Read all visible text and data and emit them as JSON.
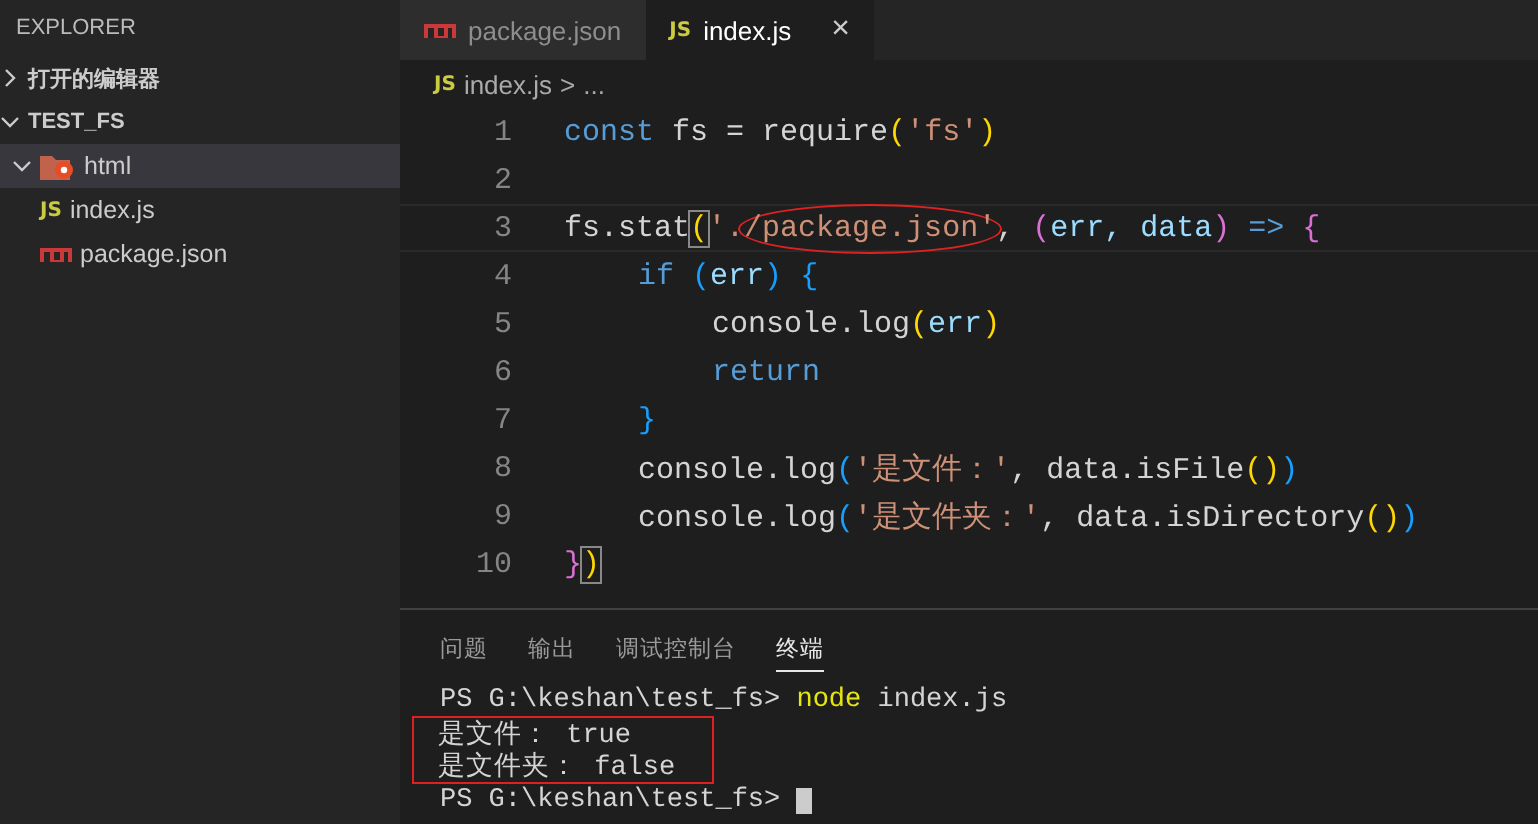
{
  "sidebar": {
    "title": "EXPLORER",
    "sections": [
      {
        "label": "打开的编辑器",
        "expanded": false
      },
      {
        "label": "TEST_FS",
        "expanded": true
      }
    ],
    "tree": [
      {
        "label": "html",
        "kind": "folder",
        "expanded": true,
        "selected": true,
        "children": [
          {
            "label": "index.js",
            "kind": "js",
            "icon_text": "JS",
            "selected": false
          },
          {
            "label": "package.json",
            "kind": "npm",
            "selected": false
          }
        ]
      }
    ]
  },
  "tabs": [
    {
      "label": "package.json",
      "kind": "npm",
      "selected": false
    },
    {
      "label": "index.js",
      "kind": "js",
      "icon_text": "JS",
      "selected": true,
      "close": "×"
    }
  ],
  "breadcrumb": {
    "icon_text": "JS",
    "file": "index.js",
    "separator": ">",
    "rest": "..."
  },
  "code_lines": [
    {
      "number": "1",
      "current": false,
      "tokens": [
        {
          "text": "const",
          "kind": "keyword"
        },
        {
          "text": " fs = require",
          "kind": "plain"
        },
        {
          "text": "(",
          "kind": "bracket1"
        },
        {
          "text": "'fs'",
          "kind": "string"
        },
        {
          "text": ")",
          "kind": "bracket1"
        }
      ]
    },
    {
      "number": "2",
      "current": false
    },
    {
      "number": "3",
      "current": true,
      "tokens": [
        {
          "text": "fs.stat",
          "kind": "plain"
        },
        {
          "text": "(",
          "kind": "bracket1",
          "matched": true
        },
        {
          "text": "'.",
          "kind": "string"
        },
        {
          "text": "/package.json'",
          "kind": "string",
          "circled": true
        },
        {
          "text": ", ",
          "kind": "plain"
        },
        {
          "text": "(",
          "kind": "bracket2"
        },
        {
          "text": "err, data",
          "kind": "variable"
        },
        {
          "text": ")",
          "kind": "bracket2"
        },
        {
          "text": " => ",
          "kind": "keyword"
        },
        {
          "text": "{",
          "kind": "bracket2"
        }
      ],
      "children": [
        {
          "number": "4",
          "current": false,
          "tokens": [
            {
              "text": "if ",
              "kind": "keyword"
            },
            {
              "text": "(",
              "kind": "bracket3"
            },
            {
              "text": "err",
              "kind": "variable"
            },
            {
              "text": ") ",
              "kind": "bracket3"
            },
            {
              "text": "{",
              "kind": "bracket3"
            }
          ],
          "children": [
            {
              "number": "5",
              "current": false,
              "tokens": [
                {
                  "text": "console.log",
                  "kind": "plain"
                },
                {
                  "text": "(",
                  "kind": "bracket1"
                },
                {
                  "text": "err",
                  "kind": "variable"
                },
                {
                  "text": ")",
                  "kind": "bracket1"
                }
              ]
            },
            {
              "number": "6",
              "current": false,
              "tokens": [
                {
                  "text": "return",
                  "kind": "keyword"
                }
              ]
            }
          ]
        },
        {
          "number": "7",
          "current": false,
          "tokens": [
            {
              "text": "}",
              "kind": "bracket3"
            }
          ]
        },
        {
          "number": "8",
          "current": false,
          "tokens": [
            {
              "text": "console.log",
              "kind": "plain"
            },
            {
              "text": "(",
              "kind": "bracket3"
            },
            {
              "text": "'是文件：'",
              "kind": "string"
            },
            {
              "text": ", data.isFile",
              "kind": "plain"
            },
            {
              "text": "()",
              "kind": "bracket1"
            },
            {
              "text": ")",
              "kind": "bracket3"
            }
          ]
        },
        {
          "number": "9",
          "current": false,
          "tokens": [
            {
              "text": "console.log",
              "kind": "plain"
            },
            {
              "text": "(",
              "kind": "bracket3"
            },
            {
              "text": "'是文件夹：'",
              "kind": "string"
            },
            {
              "text": ", data.isDirectory",
              "kind": "plain"
            },
            {
              "text": "()",
              "kind": "bracket1"
            },
            {
              "text": ")",
              "kind": "bracket3"
            }
          ]
        }
      ]
    },
    {
      "number": "10",
      "current": false,
      "tokens": [
        {
          "text": "}",
          "kind": "bracket2"
        },
        {
          "text": ")",
          "kind": "bracket1",
          "matched": true
        }
      ]
    }
  ],
  "panel": {
    "tabs": [
      {
        "label": "问题",
        "selected": false
      },
      {
        "label": "输出",
        "selected": false
      },
      {
        "label": "调试控制台",
        "selected": false
      },
      {
        "label": "终端",
        "selected": true
      }
    ],
    "terminal_lines": [
      {
        "boxed": false,
        "cursor": false,
        "tokens": [
          {
            "text": "PS G:\\keshan\\test_fs> ",
            "kind": "plain"
          },
          {
            "text": "node",
            "kind": "command"
          },
          {
            "text": " index.js",
            "kind": "plain"
          }
        ]
      },
      {
        "boxed": true,
        "cursor": false,
        "tokens": [
          {
            "text": "是文件： true",
            "kind": "plain"
          }
        ]
      },
      {
        "boxed": true,
        "cursor": false,
        "tokens": [
          {
            "text": "是文件夹： false",
            "kind": "plain"
          }
        ]
      },
      {
        "boxed": false,
        "cursor": true,
        "tokens": [
          {
            "text": "PS G:\\keshan\\test_fs>",
            "kind": "plain"
          }
        ]
      }
    ]
  }
}
